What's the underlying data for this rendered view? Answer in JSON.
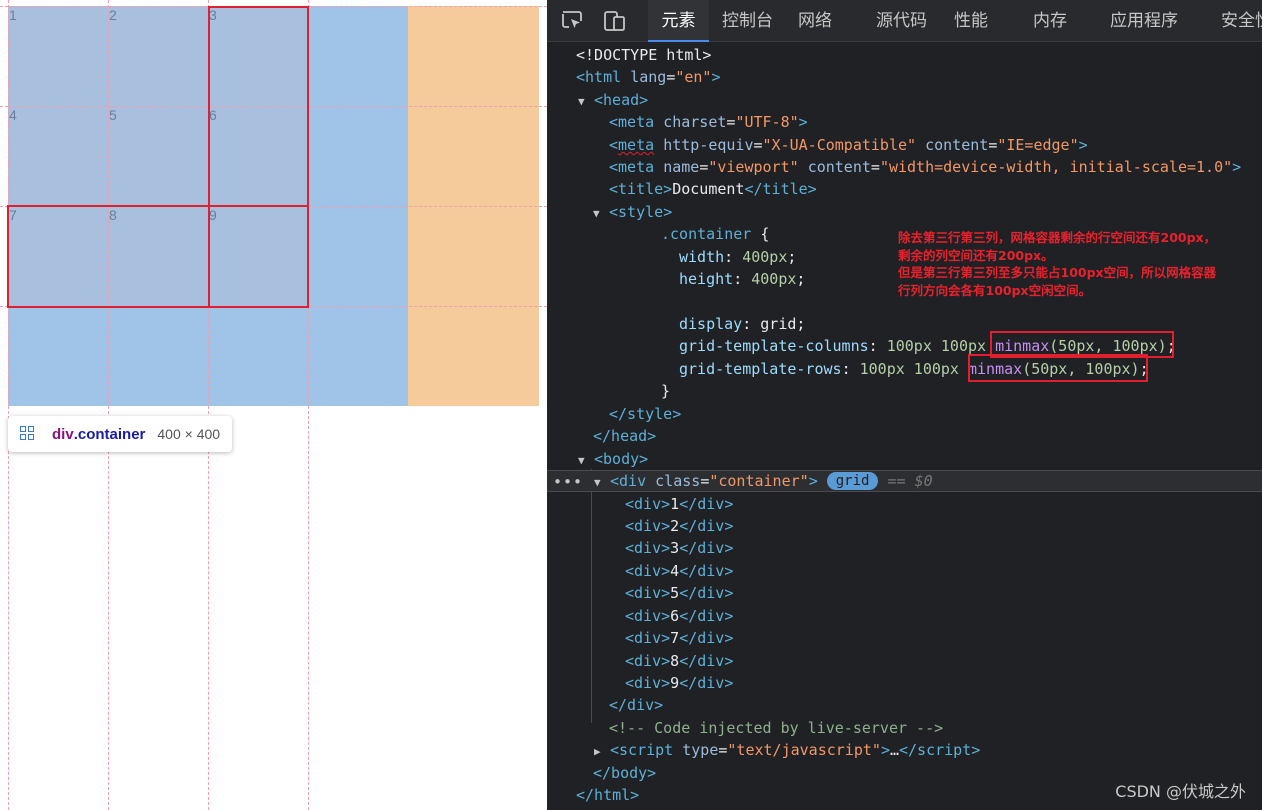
{
  "preview": {
    "cells": [
      "1",
      "2",
      "3",
      "4",
      "5",
      "6",
      "7",
      "8",
      "9"
    ],
    "tooltip": {
      "tag": "div",
      "class_name": ".container",
      "size": "400 × 400"
    }
  },
  "devtools": {
    "tabs": [
      "元素",
      "控制台",
      "网络",
      "源代码",
      "性能",
      "内存",
      "应用程序",
      "安全性"
    ],
    "active_tab": "元素",
    "selected_badge": "grid",
    "selected_marker": "== $0",
    "watermark": "CSDN @伏城之外"
  },
  "code": {
    "doctype": "<!DOCTYPE html>",
    "html_open_tag": "html",
    "html_lang_attr": "lang",
    "html_lang_val": "\"en\"",
    "head": "head",
    "meta1": {
      "attr": "charset",
      "val": "\"UTF-8\""
    },
    "meta2": {
      "attr1": "http-equiv",
      "val1": "\"X-UA-Compatible\"",
      "attr2": "content",
      "val2": "\"IE=edge\""
    },
    "meta3": {
      "attr1": "name",
      "val1": "\"viewport\"",
      "attr2": "content",
      "val2": "\"width=device-width, initial-scale=1.0\""
    },
    "title_text": "Document",
    "style": "style",
    "css_selector": ".container",
    "css_width": {
      "prop": "width",
      "val": "400px"
    },
    "css_height": {
      "prop": "height",
      "val": "400px"
    },
    "css_display": {
      "prop": "display",
      "val": "grid"
    },
    "css_cols": {
      "prop": "grid-template-columns",
      "val": "100px 100px",
      "fn": "minmax",
      "args": "(50px, 100px)"
    },
    "css_rows": {
      "prop": "grid-template-rows",
      "val": "100px 100px",
      "fn": "minmax",
      "args": "(50px, 100px)"
    },
    "body": "body",
    "div_class_attr": "class",
    "div_class_val": "\"container\"",
    "children": [
      "1",
      "2",
      "3",
      "4",
      "5",
      "6",
      "7",
      "8",
      "9"
    ],
    "comment": "<!-- Code injected by live-server -->",
    "script_attr": "type",
    "script_val": "\"text/javascript\""
  },
  "annotation": [
    "除去第三行第三列，网格容器剩余的行空间还有200px，",
    "剩余的列空间还有200px。",
    "但是第三行第三列至多只能占100px空间，所以网格容器",
    "行列方向会各有100px空闲空间。"
  ]
}
